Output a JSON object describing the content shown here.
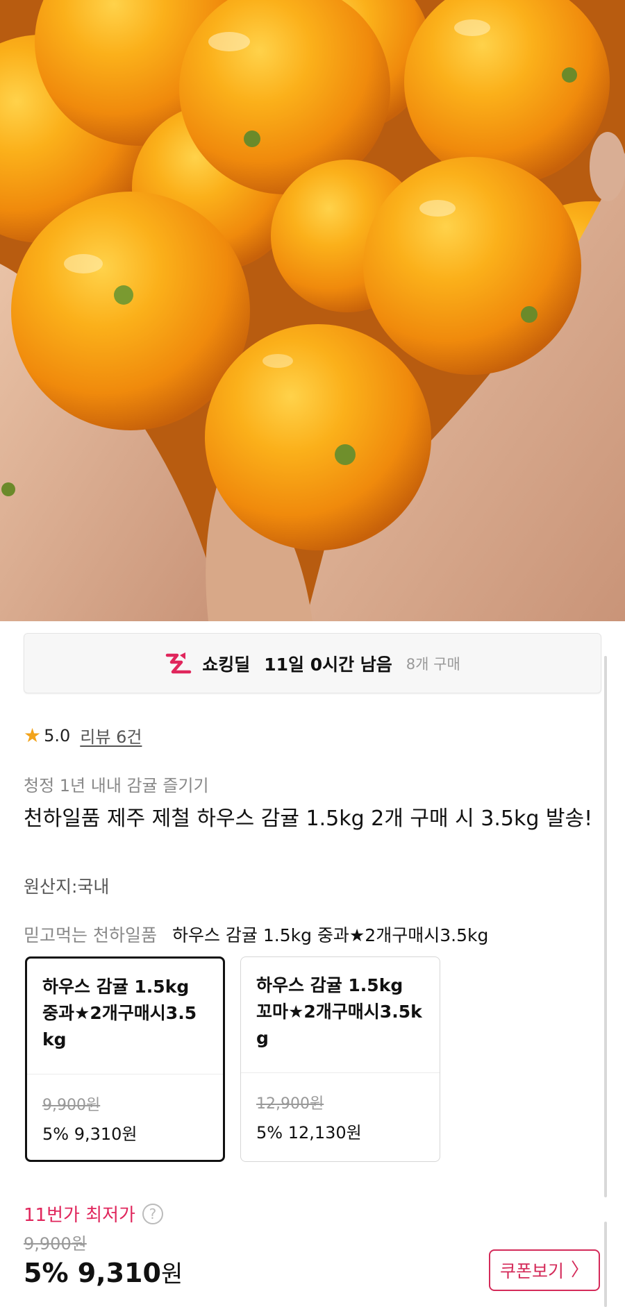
{
  "hero": {
    "image": "hands-holding-tangerines-photo"
  },
  "deal": {
    "logo_icon": "shocking-deal-logo-icon",
    "label": "쇼킹딜",
    "remaining": "11일 0시간 남음",
    "purchases": "8개 구매"
  },
  "rating": {
    "star_icon": "star-icon",
    "score": "5.0",
    "review_link": "리뷰 6건"
  },
  "product": {
    "subtitle": "청정 1년 내내 감귤 즐기기",
    "title": "천하일품 제주 제철 하우스 감귤 1.5kg 2개 구매 시 3.5kg 발송!",
    "origin": "원산지:국내"
  },
  "option": {
    "seller": "믿고먹는 천하일품",
    "selected_name": "하우스 감귤 1.5kg 중과★2개구매시3.5kg",
    "cards": [
      {
        "name": "하우스 감귤 1.5kg 중과★2개구매시3.5kg",
        "original_price": "9,900원",
        "discounted": "5% 9,310원",
        "selected": true
      },
      {
        "name": "하우스 감귤 1.5kg 꼬마★2개구매시3.5kg",
        "original_price": "12,900원",
        "discounted": "5% 12,130원",
        "selected": false
      }
    ]
  },
  "price": {
    "lowest_label": "11번가 최저가",
    "help_icon": "question-icon",
    "help_glyph": "?",
    "original": "9,900원",
    "discount_amount": "5% 9,310",
    "won": "원"
  },
  "coupon": {
    "label": "쿠폰보기",
    "chevron_icon": "chevron-right-icon",
    "chevron_glyph": "〉"
  },
  "colors": {
    "accent_red": "#e0265c",
    "coupon_border": "#d42a59",
    "star": "#f2a31b"
  }
}
